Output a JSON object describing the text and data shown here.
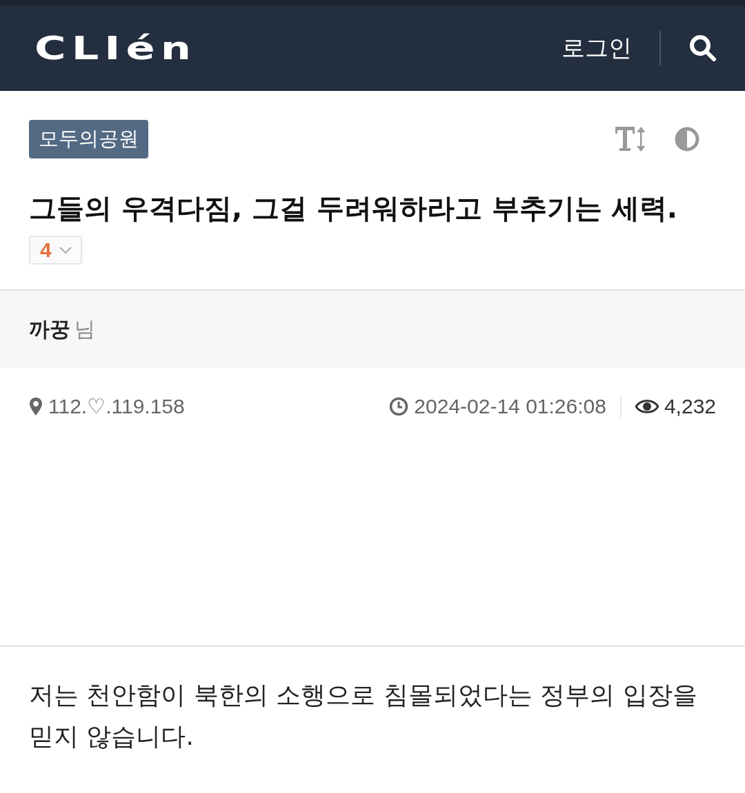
{
  "header": {
    "logo": "CLIén",
    "login": "로그인"
  },
  "post": {
    "board": "모두의공원",
    "title": "그들의 우격다짐, 그걸 두려워하라고 부추기는 세력.",
    "votes": "4",
    "author": {
      "nickname": "까꿍",
      "suffix": "님"
    },
    "ip": "112.♡.119.158",
    "datetime": "2024-02-14 01:26:08",
    "views": "4,232",
    "body": "저는 천안함이 북한의 소행으로 침몰되었다는 정부의 입장을 믿지 않습니다."
  }
}
